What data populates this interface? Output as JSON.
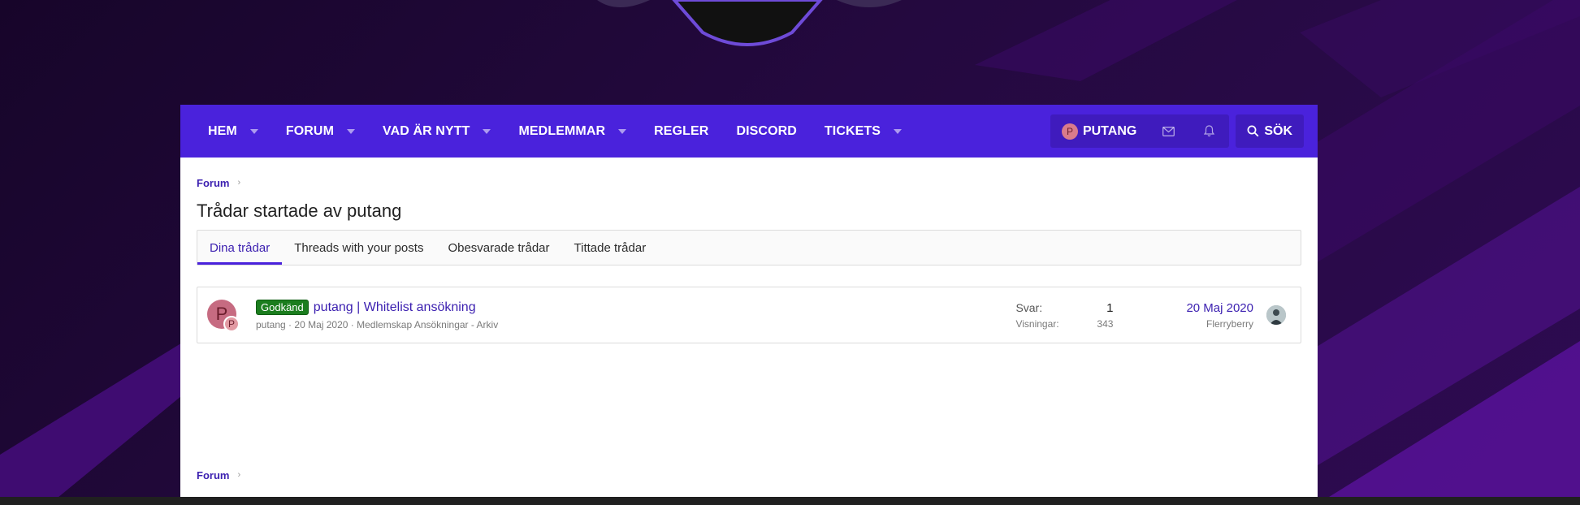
{
  "nav": {
    "items": [
      {
        "label": "HEM",
        "has_dropdown": true
      },
      {
        "label": "FORUM",
        "has_dropdown": true
      },
      {
        "label": "VAD ÄR NYTT",
        "has_dropdown": true
      },
      {
        "label": "MEDLEMMAR",
        "has_dropdown": true
      },
      {
        "label": "REGLER",
        "has_dropdown": false
      },
      {
        "label": "DISCORD",
        "has_dropdown": false
      },
      {
        "label": "TICKETS",
        "has_dropdown": true
      }
    ],
    "user": {
      "initial": "P",
      "name": "PUTANG"
    },
    "inbox_icon": "envelope-icon",
    "alerts_icon": "bell-icon",
    "search_label": "SÖK"
  },
  "breadcrumb": {
    "items": [
      "Forum"
    ]
  },
  "page_title": "Trådar startade av putang",
  "tabs": [
    {
      "label": "Dina trådar",
      "active": true
    },
    {
      "label": "Threads with your posts",
      "active": false
    },
    {
      "label": "Obesvarade trådar",
      "active": false
    },
    {
      "label": "Tittade trådar",
      "active": false
    }
  ],
  "thread": {
    "avatar_initial": "P",
    "badge_initial": "P",
    "prefix": "Godkänd",
    "title": "putang | Whitelist ansökning",
    "author": "putang",
    "date": "20 Maj 2020",
    "forum": "Medlemskap Ansökningar - Arkiv",
    "replies_label": "Svar:",
    "replies_value": "1",
    "views_label": "Visningar:",
    "views_value": "343",
    "latest_date": "20 Maj 2020",
    "latest_user": "Flerryberry"
  },
  "bottom_breadcrumb": {
    "items": [
      "Forum"
    ]
  },
  "colors": {
    "nav_bg": "#4a22dc",
    "link": "#3b1fb0",
    "prefix_bg": "#1b7d1e",
    "page_bg": "#1a0730"
  }
}
